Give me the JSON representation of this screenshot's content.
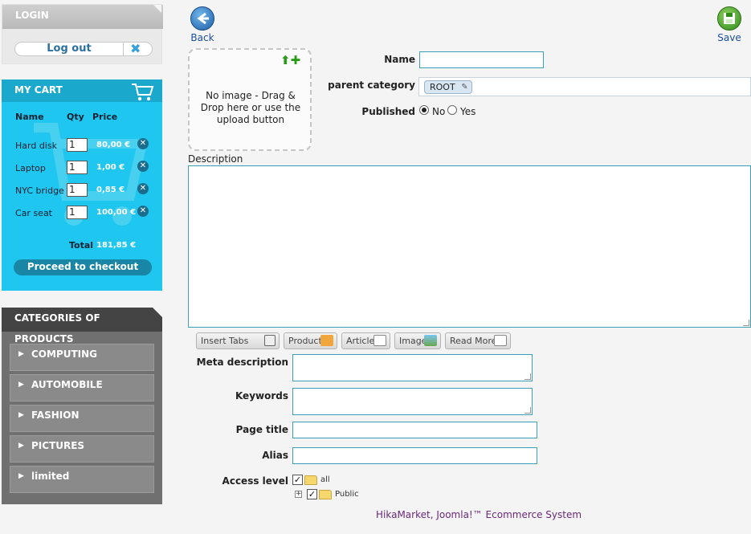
{
  "sidebar": {
    "login": {
      "title": "LOGIN",
      "logout_label": "Log out"
    },
    "cart": {
      "title": "MY CART",
      "headers": {
        "name": "Name",
        "qty": "Qty",
        "price": "Price"
      },
      "items": [
        {
          "name": "Hard disk",
          "qty": "1",
          "price": "80,00 €"
        },
        {
          "name": "Laptop",
          "qty": "1",
          "price": "1,00 €"
        },
        {
          "name": "NYC bridge",
          "qty": "1",
          "price": "0,85 €"
        },
        {
          "name": "Car seat",
          "qty": "1",
          "price": "100,00 €"
        }
      ],
      "total_label": "Total",
      "total_value": "181,85 €",
      "checkout_label": "Proceed to checkout"
    },
    "categories": {
      "title": "CATEGORIES OF PRODUCTS",
      "items": [
        "COMPUTING",
        "AUTOMOBILE",
        "FASHION",
        "PICTURES",
        "limited"
      ]
    }
  },
  "toolbar": {
    "back_label": "Back",
    "save_label": "Save"
  },
  "image_zone": {
    "text": "No image - Drag & Drop here or use the upload button"
  },
  "form": {
    "name_label": "Name",
    "name_value": "",
    "parent_category_label": "parent category",
    "parent_category_value": "ROOT",
    "published_label": "Published",
    "published_options": [
      "No",
      "Yes"
    ],
    "published_selected": "No",
    "description_label": "Description",
    "editor_buttons": [
      "Insert Tabs",
      "Product",
      "Article",
      "Image",
      "Read More"
    ],
    "meta_description_label": "Meta description",
    "keywords_label": "Keywords",
    "page_title_label": "Page title",
    "alias_label": "Alias",
    "access_level_label": "Access level",
    "access_tree": [
      {
        "label": "all",
        "checked": true
      },
      {
        "label": "Public",
        "checked": true
      }
    ]
  },
  "footer": {
    "text": "HikaMarket, Joomla!™ Ecommerce System"
  },
  "colors": {
    "cart_bg": "#1fc6ef",
    "cart_header": "#1aa8cc",
    "categories_bg": "#707070",
    "accent_input": "#3aa0b8",
    "footer_text": "#6a2a7a"
  }
}
